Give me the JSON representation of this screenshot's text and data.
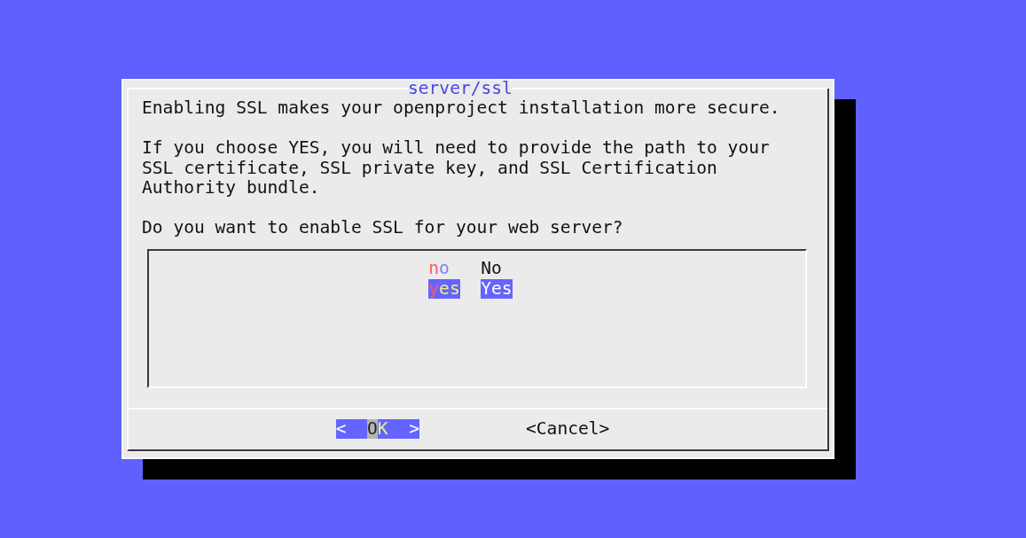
{
  "dialog": {
    "title": "server/ssl",
    "message": [
      "Enabling SSL makes your openproject installation more secure.",
      "If you choose YES, you will need to provide the path to your SSL certificate, SSL private key, and SSL Certification Authority bundle.",
      "Do you want to enable SSL for your web server?"
    ],
    "menu": {
      "items": [
        {
          "tag": "no",
          "description": "No",
          "selected": false
        },
        {
          "tag": "yes",
          "description": "Yes",
          "selected": true
        }
      ]
    },
    "buttons": [
      {
        "bracket_left": "<",
        "label": "OK",
        "bracket_right": ">",
        "selected": true
      },
      {
        "bracket_left": "<",
        "label": "Cancel",
        "bracket_right": ">",
        "selected": false
      }
    ]
  }
}
